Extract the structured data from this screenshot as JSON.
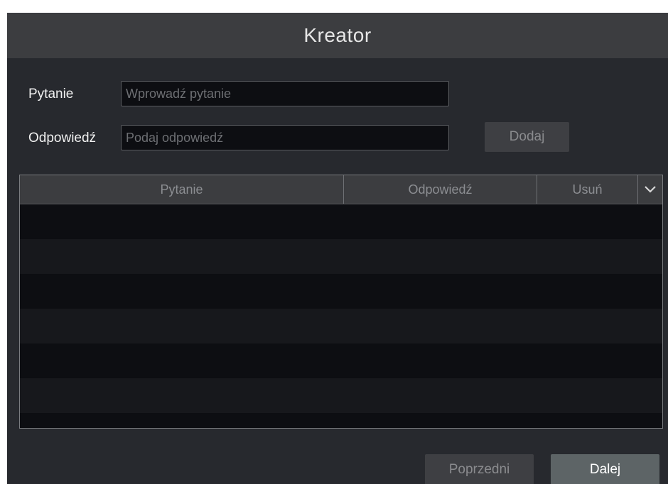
{
  "dialog": {
    "title": "Kreator"
  },
  "form": {
    "question_label": "Pytanie",
    "question_placeholder": "Wprowadź pytanie",
    "question_value": "",
    "answer_label": "Odpowiedź",
    "answer_placeholder": "Podaj odpowiedź",
    "answer_value": "",
    "add_button": "Dodaj"
  },
  "table": {
    "columns": [
      "Pytanie",
      "Odpowiedź",
      "Usuń"
    ],
    "menu_icon": "chevron-down-icon",
    "rows": []
  },
  "footer": {
    "previous_button": "Poprzedni",
    "next_button": "Dalej"
  },
  "colors": {
    "background": "#27292e",
    "titlebar": "#3c3d40",
    "input_bg": "#0d0e12",
    "primary_button": "#5d6466"
  }
}
